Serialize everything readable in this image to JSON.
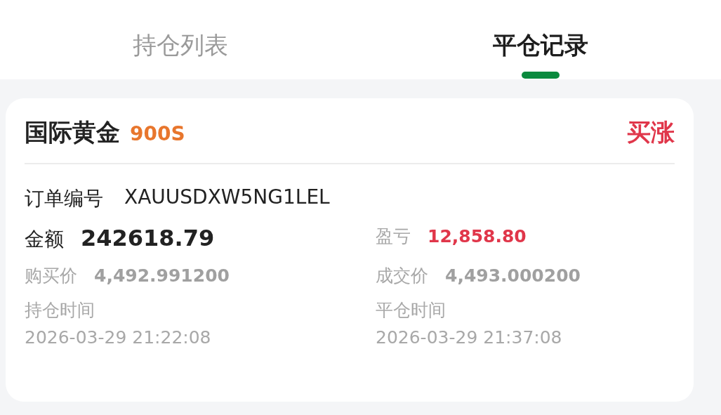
{
  "tabs": [
    {
      "label": "持仓列表",
      "selected": false
    },
    {
      "label": "平仓记录",
      "selected": true
    }
  ],
  "card": {
    "name": "国际黄金",
    "code": "900S",
    "direction": "买涨",
    "order": {
      "label": "订单编号",
      "value": "XAUUSDXW5NG1LEL"
    },
    "fields": [
      {
        "kind": "amount",
        "label": "金额",
        "value": "242618.79"
      },
      {
        "kind": "pnl",
        "label": "盈亏",
        "value": "12,858.80"
      },
      {
        "kind": "price",
        "label": "购买价",
        "value": "4,492.991200"
      },
      {
        "kind": "price",
        "label": "成交价",
        "value": "4,493.000200"
      },
      {
        "kind": "time",
        "label": "持仓时间",
        "value": "2026-03-29 21:22:08"
      },
      {
        "kind": "time",
        "label": "平仓时间",
        "value": "2026-03-29 21:37:08"
      }
    ]
  }
}
